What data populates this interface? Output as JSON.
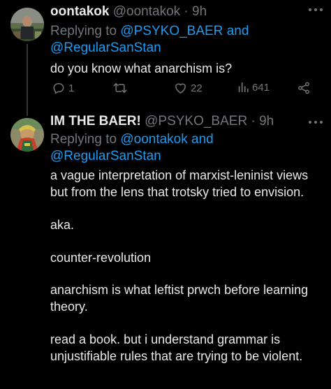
{
  "tweet1": {
    "name": "oontakok",
    "handle": "@oontakok",
    "separator": "·",
    "time": "9h",
    "replying_to_label": "Replying to",
    "mention_1": "@PSYKO_BAER",
    "and_label": "and",
    "mention_2": "@RegularSanStan",
    "body": "do you know what anarchism is?",
    "reply_count": "1",
    "like_count": "22",
    "view_count": "641"
  },
  "tweet2": {
    "name": "IM THE BAER!",
    "handle": "@PSYKO_BAER",
    "separator": "·",
    "time": "9h",
    "replying_to_label": "Replying to",
    "mention_1": "@oontakok",
    "and_label": "and",
    "mention_2": "@RegularSanStan",
    "paragraphs": [
      "a vague interpretation of marxist-leninist views but from the lens that trotsky tried to envision.",
      "aka.",
      "counter-revolution",
      "anarchism is what leftist prwch before learning theory.",
      "read a book. but i understand grammar is unjustifiable rules that are trying to be violent."
    ]
  },
  "icons": {
    "more": "more-dots-icon",
    "reply": "reply-icon",
    "retweet": "retweet-icon",
    "like": "heart-icon",
    "views": "views-bar-chart-icon",
    "share": "share-icon"
  },
  "colors": {
    "background": "#000000",
    "text": "#e7e9ea",
    "muted": "#71767b",
    "link": "#1d9bf0",
    "thread_line": "#333639"
  }
}
